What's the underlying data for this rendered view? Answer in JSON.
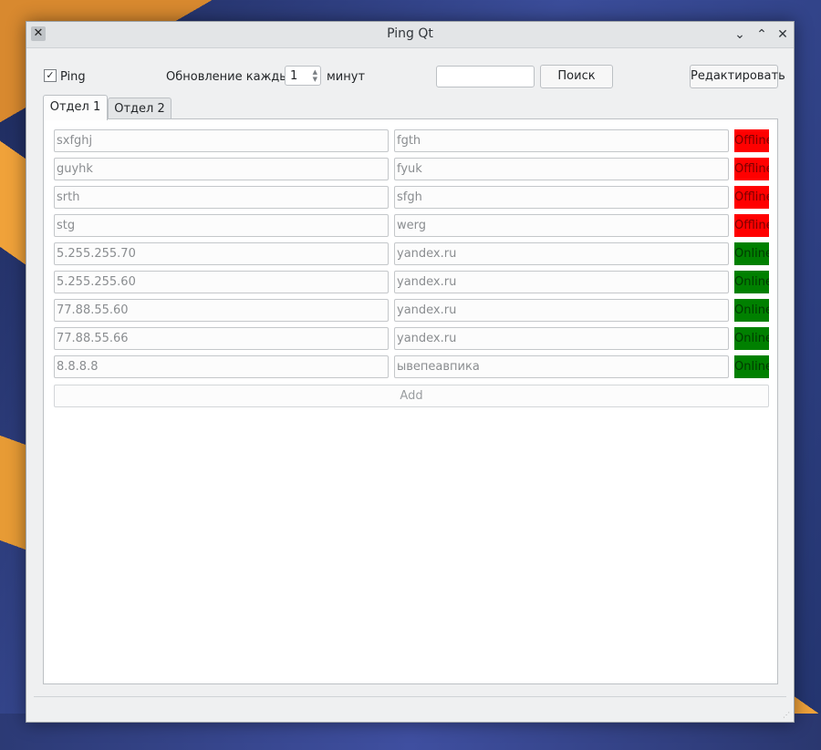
{
  "window": {
    "title": "Ping Qt"
  },
  "toolbar": {
    "ping_checked": "✓",
    "ping_label": "Ping",
    "update_label": "Обновление каждые",
    "update_value": "1",
    "minutes_label": "минут",
    "search_value": "",
    "search_button": "Поиск",
    "edit_button": "Редактировать"
  },
  "tabs": [
    {
      "label": "Отдел 1",
      "active": true
    },
    {
      "label": "Отдел 2",
      "active": false
    }
  ],
  "rows": [
    {
      "host": "sxfghj",
      "name": "fgth",
      "status": "Offline"
    },
    {
      "host": "guyhk",
      "name": "fyuk",
      "status": "Offline"
    },
    {
      "host": "srth",
      "name": "sfgh",
      "status": "Offline"
    },
    {
      "host": "stg",
      "name": "werg",
      "status": "Offline"
    },
    {
      "host": "5.255.255.70",
      "name": "yandex.ru",
      "status": "Online"
    },
    {
      "host": "5.255.255.60",
      "name": "yandex.ru",
      "status": "Online"
    },
    {
      "host": "77.88.55.60",
      "name": "yandex.ru",
      "status": "Online"
    },
    {
      "host": "77.88.55.66",
      "name": "yandex.ru",
      "status": "Online"
    },
    {
      "host": "8.8.8.8",
      "name": "ывепеавпика",
      "status": "Online"
    }
  ],
  "add_button": "Add",
  "colors": {
    "offline_bg": "#ff0000",
    "offline_text": "#7a0000",
    "online_bg": "#008000",
    "online_text": "#003a00"
  }
}
